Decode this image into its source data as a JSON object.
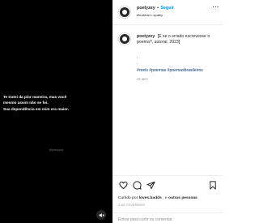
{
  "media": {
    "overlay_lines": [
      "Te tratei da pior maneira, mas você",
      "mesmo assim não se foi.",
      "Sua dependência em mim era maior."
    ],
    "watermark": "@poetyzey",
    "mute_icon": "speaker-muted-icon"
  },
  "header": {
    "username": "poetyzey",
    "separator": "•",
    "follow_label": "Seguir",
    "audio": "Ønwheart • apathy",
    "more_icon": "more-icon",
    "more_label": "···"
  },
  "caption": {
    "username": "poetyzey",
    "text": "[E se o errado escrevesse o poema?, autoral, 2023]",
    "dots": [
      ".",
      "."
    ],
    "hashtags": "#reels #poemas #poemasbrasileiros",
    "time_ago": "41 sem"
  },
  "actions": {
    "like_icon": "heart-icon",
    "comment_icon": "comment-icon",
    "share_icon": "share-icon",
    "save_icon": "bookmark-icon"
  },
  "likes": {
    "prefix": "Curtido por",
    "user": "loves.badds_",
    "middle": "e",
    "others": "outras pessoas"
  },
  "post_date": "4 DE FEVEREIRO",
  "comment_bar": {
    "text": "Entrar para curtir ou comentar."
  },
  "colors": {
    "accent": "#0095f6",
    "hashtag": "#00376b",
    "media_background": "#000000"
  }
}
